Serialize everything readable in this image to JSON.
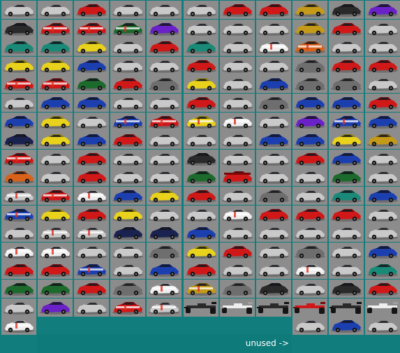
{
  "sheet": {
    "title": "",
    "unused_label": "unused ->"
  },
  "colors": {
    "background": "#0e7a7a",
    "cell_background": "#8c8c8c",
    "label": "#ffffff"
  },
  "sprites": [
    [
      "silver",
      "silver",
      "red",
      "silver",
      "silver",
      "silver",
      "red",
      "red",
      "gold",
      "black",
      "purple"
    ],
    [
      "black",
      "red-livery",
      "red-livery",
      "green-livery",
      "purple",
      "silver",
      "silver",
      "silver",
      "gold",
      "red",
      "silver"
    ],
    [
      "teal",
      "teal",
      "yellow",
      "silver",
      "red",
      "teal",
      "silver",
      "white-livery",
      "orange-livery",
      "silver",
      "silver"
    ],
    [
      "yellow",
      "yellow",
      "blue",
      "silver",
      "silver",
      "red",
      "silver",
      "silver",
      "gray",
      "red",
      "red"
    ],
    [
      "red-livery",
      "red-livery",
      "green",
      "red",
      "gray",
      "yellow",
      "silver",
      "blue",
      "gray",
      "gray",
      "silver"
    ],
    [
      "silver",
      "blue",
      "blue",
      "silver",
      "silver",
      "red",
      "silver",
      "gray",
      "blue",
      "blue",
      "red"
    ],
    [
      "blue",
      "yellow",
      "silver",
      "blue-livery",
      "red-livery",
      "yellow-livery",
      "white-livery",
      "silver",
      "purple",
      "blue-livery",
      "blue"
    ],
    [
      "navy",
      "yellow",
      "blue",
      "red",
      "silver",
      "silver",
      "silver",
      "blue",
      "blue",
      "yellow",
      "gold"
    ],
    [
      "red-livery",
      "silver",
      "red",
      "silver",
      "silver",
      "black",
      "silver",
      "silver",
      "red",
      "blue",
      "silver"
    ],
    [
      "orange",
      "silver",
      "red",
      "silver",
      "silver",
      "green",
      "red-prototype",
      "silver",
      "silver",
      "green",
      "silver"
    ],
    [
      "silver-livery",
      "red-livery",
      "white-livery",
      "blue",
      "yellow",
      "red",
      "silver",
      "gray",
      "silver",
      "teal",
      "blue"
    ],
    [
      "blue-livery",
      "yellow",
      "red",
      "yellow",
      "silver",
      "silver",
      "white-livery",
      "red",
      "red",
      "red",
      "silver"
    ],
    [
      "silver",
      "silver-livery",
      "silver-livery",
      "navy",
      "navy",
      "blue",
      "silver",
      "silver",
      "silver",
      "silver",
      "silver"
    ],
    [
      "white-livery",
      "white-livery",
      "silver",
      "silver",
      "gray",
      "yellow",
      "red",
      "silver",
      "gray",
      "silver",
      "blue"
    ],
    [
      "red",
      "red",
      "blue-livery",
      "silver",
      "blue",
      "red",
      "silver",
      "silver",
      "white-livery",
      "silver",
      "teal"
    ],
    [
      "green",
      "green",
      "red",
      "gray",
      "white-livery",
      "gold-livery",
      "gray",
      "black",
      "silver",
      "black",
      "red"
    ],
    [
      "silver",
      "purple",
      "silver",
      "red-livery",
      "silver-livery",
      "formula-black",
      "formula-white",
      "formula-black",
      "formula-red",
      "formula-black",
      "formula-white"
    ],
    [
      "white-livery",
      "",
      "",
      "",
      "",
      "",
      "",
      "",
      "silver",
      "blue",
      "silver"
    ]
  ]
}
